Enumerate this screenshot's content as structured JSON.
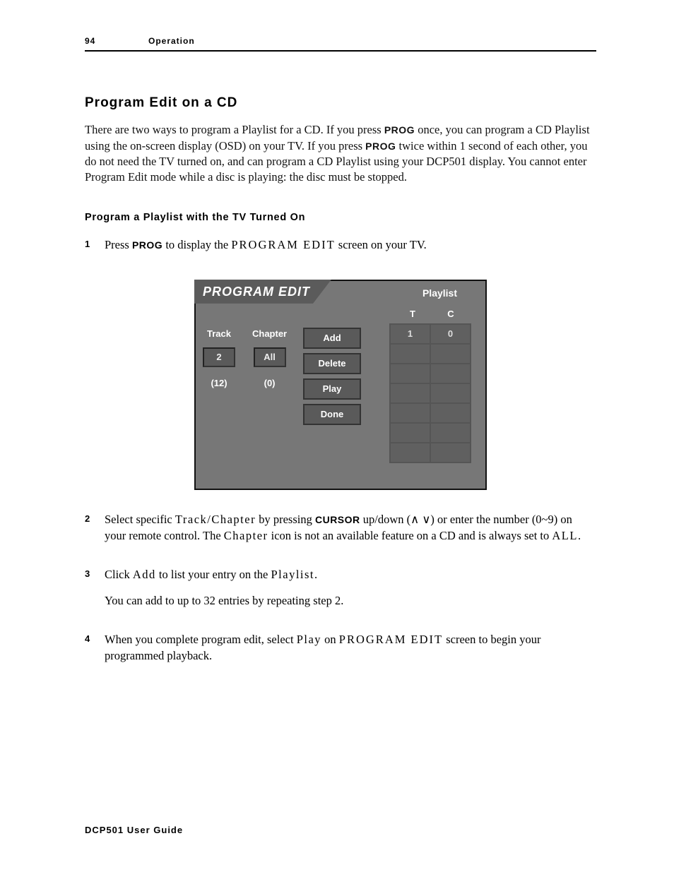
{
  "header": {
    "page_number": "94",
    "section": "Operation"
  },
  "title": "Program Edit on a CD",
  "intro": {
    "part1": "There are two ways to program a Playlist for a CD. If you press ",
    "prog1": "PROG",
    "part2": " once, you can program a CD Playlist using the on-screen display (OSD) on your TV. If you press ",
    "prog2": "PROG",
    "part3": " twice within 1 second of each other, you do not need the TV turned on, and can program a CD Playlist using your DCP501 display. You cannot enter Program Edit mode while a disc is playing: the disc must be stopped."
  },
  "subsection": "Program a Playlist with the TV Turned On",
  "steps": [
    {
      "num": "1",
      "parts": {
        "a": "Press ",
        "prog": "PROG",
        "b": " to display the ",
        "screen": "PROGRAM EDIT",
        "c": " screen on your TV."
      }
    },
    {
      "num": "2",
      "parts": {
        "a": "Select specific ",
        "tc": "Track/Chapter",
        "b": " by pressing ",
        "cursor": "CURSOR",
        "c": " up/down (∧  ∨) or enter the number (0~9) on your remote control. The ",
        "chapter": "Chapter",
        "d": " icon is not an available feature on a CD and is always set to ",
        "all": "ALL",
        "e": "."
      }
    },
    {
      "num": "3",
      "parts": {
        "a": "Click ",
        "add": "Add",
        "b": " to list your entry on the ",
        "playlist": "Playlist",
        "c": ".",
        "p2": "You can add to up to 32 entries by repeating step 2."
      }
    },
    {
      "num": "4",
      "parts": {
        "a": "When you complete program edit, select ",
        "play": "Play",
        "b": " on ",
        "screen": "PROGRAM EDIT",
        "c": " screen to begin your programmed playback."
      }
    }
  ],
  "osd": {
    "title": "PROGRAM EDIT",
    "playlist_label": "Playlist",
    "col_t": "T",
    "col_c": "C",
    "row1_t": "1",
    "row1_c": "0",
    "track_label": "Track",
    "chapter_label": "Chapter",
    "track_value": "2",
    "chapter_value": "All",
    "track_count": "(12)",
    "chapter_count": "(0)",
    "buttons": [
      "Add",
      "Delete",
      "Play",
      "Done"
    ]
  },
  "footer": "DCP501 User Guide"
}
